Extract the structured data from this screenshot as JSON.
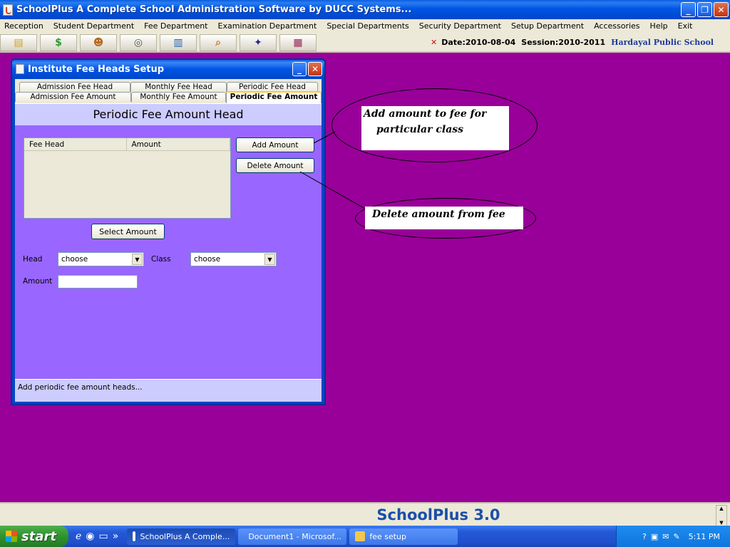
{
  "app": {
    "title": "SchoolPlus   A Complete School Administration Software by DUCC Systems...",
    "minimize": "_",
    "maximize": "❐",
    "close": "✕"
  },
  "menu": [
    "Reception",
    "Student Department",
    "Fee Department",
    "Examination Department",
    "Special Departments",
    "Security Department",
    "Setup Department",
    "Accessories",
    "Help",
    "Exit"
  ],
  "toolbar": {
    "icons": [
      "money-icon",
      "dollar-icon",
      "people-icon",
      "safe-icon",
      "books-icon",
      "search-icon",
      "badge-icon",
      "grid-icon"
    ],
    "date": "Date:2010-08-04",
    "session": "Session:2010-2011",
    "school": "Hardayal Public School"
  },
  "frame": {
    "title": "Institute Fee Heads Setup",
    "tabs_row1": [
      "Admission Fee Head",
      "Monthly Fee Head",
      "Periodic Fee Head"
    ],
    "tabs_row2": [
      "Admission Fee Amount",
      "Monthly Fee Amount",
      "Periodic Fee Amount"
    ],
    "panel_title": "Periodic Fee Amount Head",
    "table_headers": [
      "Fee Head",
      "Amount"
    ],
    "add_button": "Add Amount",
    "delete_button": "Delete Amount",
    "select_button": "Select  Amount",
    "head_label": "Head",
    "head_value": "choose",
    "class_label": "Class",
    "class_value": "choose",
    "amount_label": "Amount",
    "amount_value": "",
    "status": "Add  periodic fee amount heads..."
  },
  "callouts": {
    "add_line1": "Add amount to fee for",
    "add_line2": "particular class",
    "delete": "Delete amount from fee"
  },
  "bottom": {
    "brand": "SchoolPlus 3.0"
  },
  "taskbar": {
    "start": "start",
    "tasks": [
      "SchoolPlus   A Comple...",
      "Document1 - Microsof...",
      "fee setup"
    ],
    "time": "5:11 PM"
  },
  "colors": {
    "desktop": "#990099",
    "panel": "#9966ff",
    "panel_header": "#ccccff",
    "xp_blue": "#0055e5"
  }
}
